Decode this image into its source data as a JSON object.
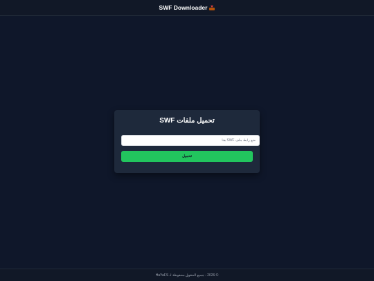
{
  "header": {
    "title": "SWF Downloader",
    "icon": "inbox-tray-icon"
  },
  "card": {
    "title": "تحميل ملفات SWF",
    "input_placeholder": "ضع رابط ملف SWF هنا",
    "input_value": "",
    "download_label": "تحميل"
  },
  "footer": {
    "text": "© 2026 - جميع الحقوق محفوظة لـ HaYaFS"
  },
  "colors": {
    "background": "#0f172a",
    "header_bg": "#111827",
    "card_bg": "#1e293b",
    "accent": "#22c55e"
  }
}
